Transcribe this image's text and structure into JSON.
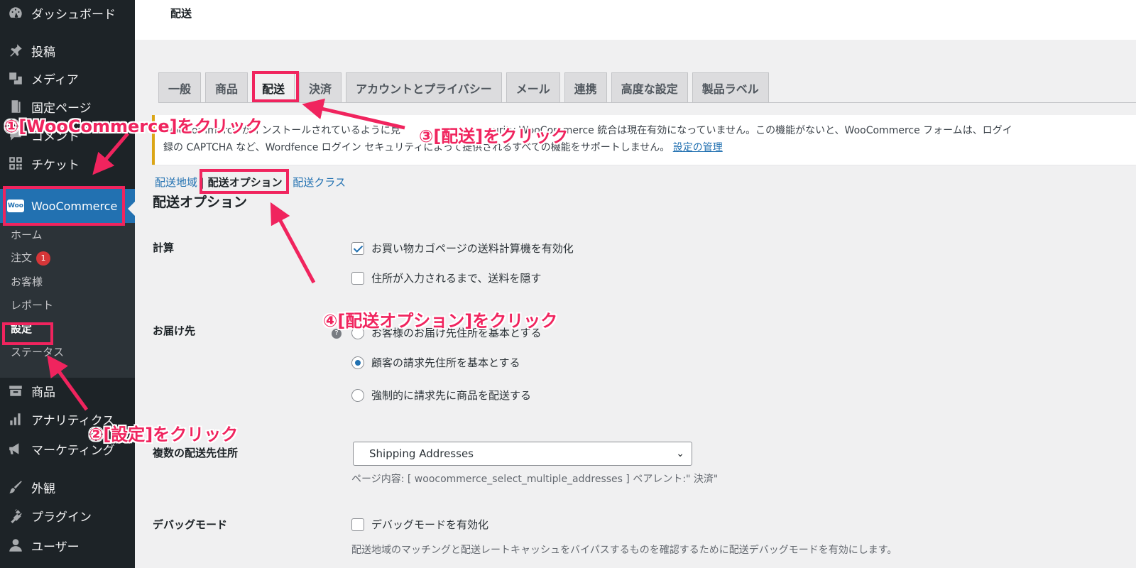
{
  "sidebar": {
    "items": [
      {
        "label": "ダッシュボード",
        "icon": "dashboard-icon"
      },
      {
        "label": "投稿",
        "icon": "pin-icon"
      },
      {
        "label": "メディア",
        "icon": "media-icon"
      },
      {
        "label": "固定ページ",
        "icon": "page-icon"
      },
      {
        "label": "コメント",
        "icon": "comment-icon"
      },
      {
        "label": "チケット",
        "icon": "ticket-icon"
      }
    ],
    "woocommerce": {
      "label": "WooCommerce",
      "logo_text": "Woo"
    },
    "submenu": [
      {
        "label": "ホーム"
      },
      {
        "label": "注文",
        "badge": "1"
      },
      {
        "label": "お客様"
      },
      {
        "label": "レポート"
      },
      {
        "label": "設定"
      },
      {
        "label": "ステータス"
      }
    ],
    "items_after": [
      {
        "label": "商品",
        "icon": "product-icon"
      },
      {
        "label": "アナリティクス",
        "icon": "analytics-icon"
      },
      {
        "label": "マーケティング",
        "icon": "megaphone-icon"
      },
      {
        "label": "外観",
        "icon": "brush-icon"
      },
      {
        "label": "プラグイン",
        "icon": "plugin-icon"
      },
      {
        "label": "ユーザー",
        "icon": "user-icon"
      }
    ]
  },
  "header": {
    "title": "配送"
  },
  "tabs": [
    "一般",
    "商品",
    "配送",
    "決済",
    "アカウントとプライバシー",
    "メール",
    "連携",
    "高度な設定",
    "製品ラベル"
  ],
  "notice": {
    "line1_start": "WooCommerce がインストールされているように見",
    "line1_end": "urity WooCommerce 統合は現在有効になっていません。この機能がないと、WooCommerce フォームは、ログイ",
    "line2": "録の CAPTCHA など、Wordfence ログイン セキュリティによって提供されるすべての機能をサポートしません。",
    "link": "設定の管理"
  },
  "subnav": {
    "zones": "配送地域",
    "sep": "|",
    "options": "配送オプション",
    "classes": "配送クラス"
  },
  "section_title": "配送オプション",
  "fields": {
    "calc": {
      "label": "計算",
      "opt1": "お買い物カゴページの送料計算機を有効化",
      "opt2": "住所が入力されるまで、送料を隠す"
    },
    "destination": {
      "label": "お届け先",
      "opt1": "お客様のお届け先住所を基本とする",
      "opt2": "顧客の請求先住所を基本とする",
      "opt3": "強制的に請求先に商品を配送する"
    },
    "multi": {
      "label": "複数の配送先住所",
      "value": "Shipping Addresses",
      "desc": "ページ内容: [ woocommerce_select_multiple_addresses ] ペアレント:\" 決済\""
    },
    "debug": {
      "label": "デバッグモード",
      "opt1": "デバッグモードを有効化",
      "desc": "配送地域のマッチングと配送レートキャッシュをバイパスするものを確認するために配送デバッグモードを有効にします。"
    }
  },
  "annotations": {
    "step1": "①[WooCommerce]をクリック",
    "step2": "②[設定]をクリック",
    "step3": "③[配送]をクリック",
    "step4": "④[配送オプション]をクリック"
  },
  "colors": {
    "accent": "#f0245e",
    "wp_blue": "#2271b1",
    "sidebar": "#1d2327"
  }
}
